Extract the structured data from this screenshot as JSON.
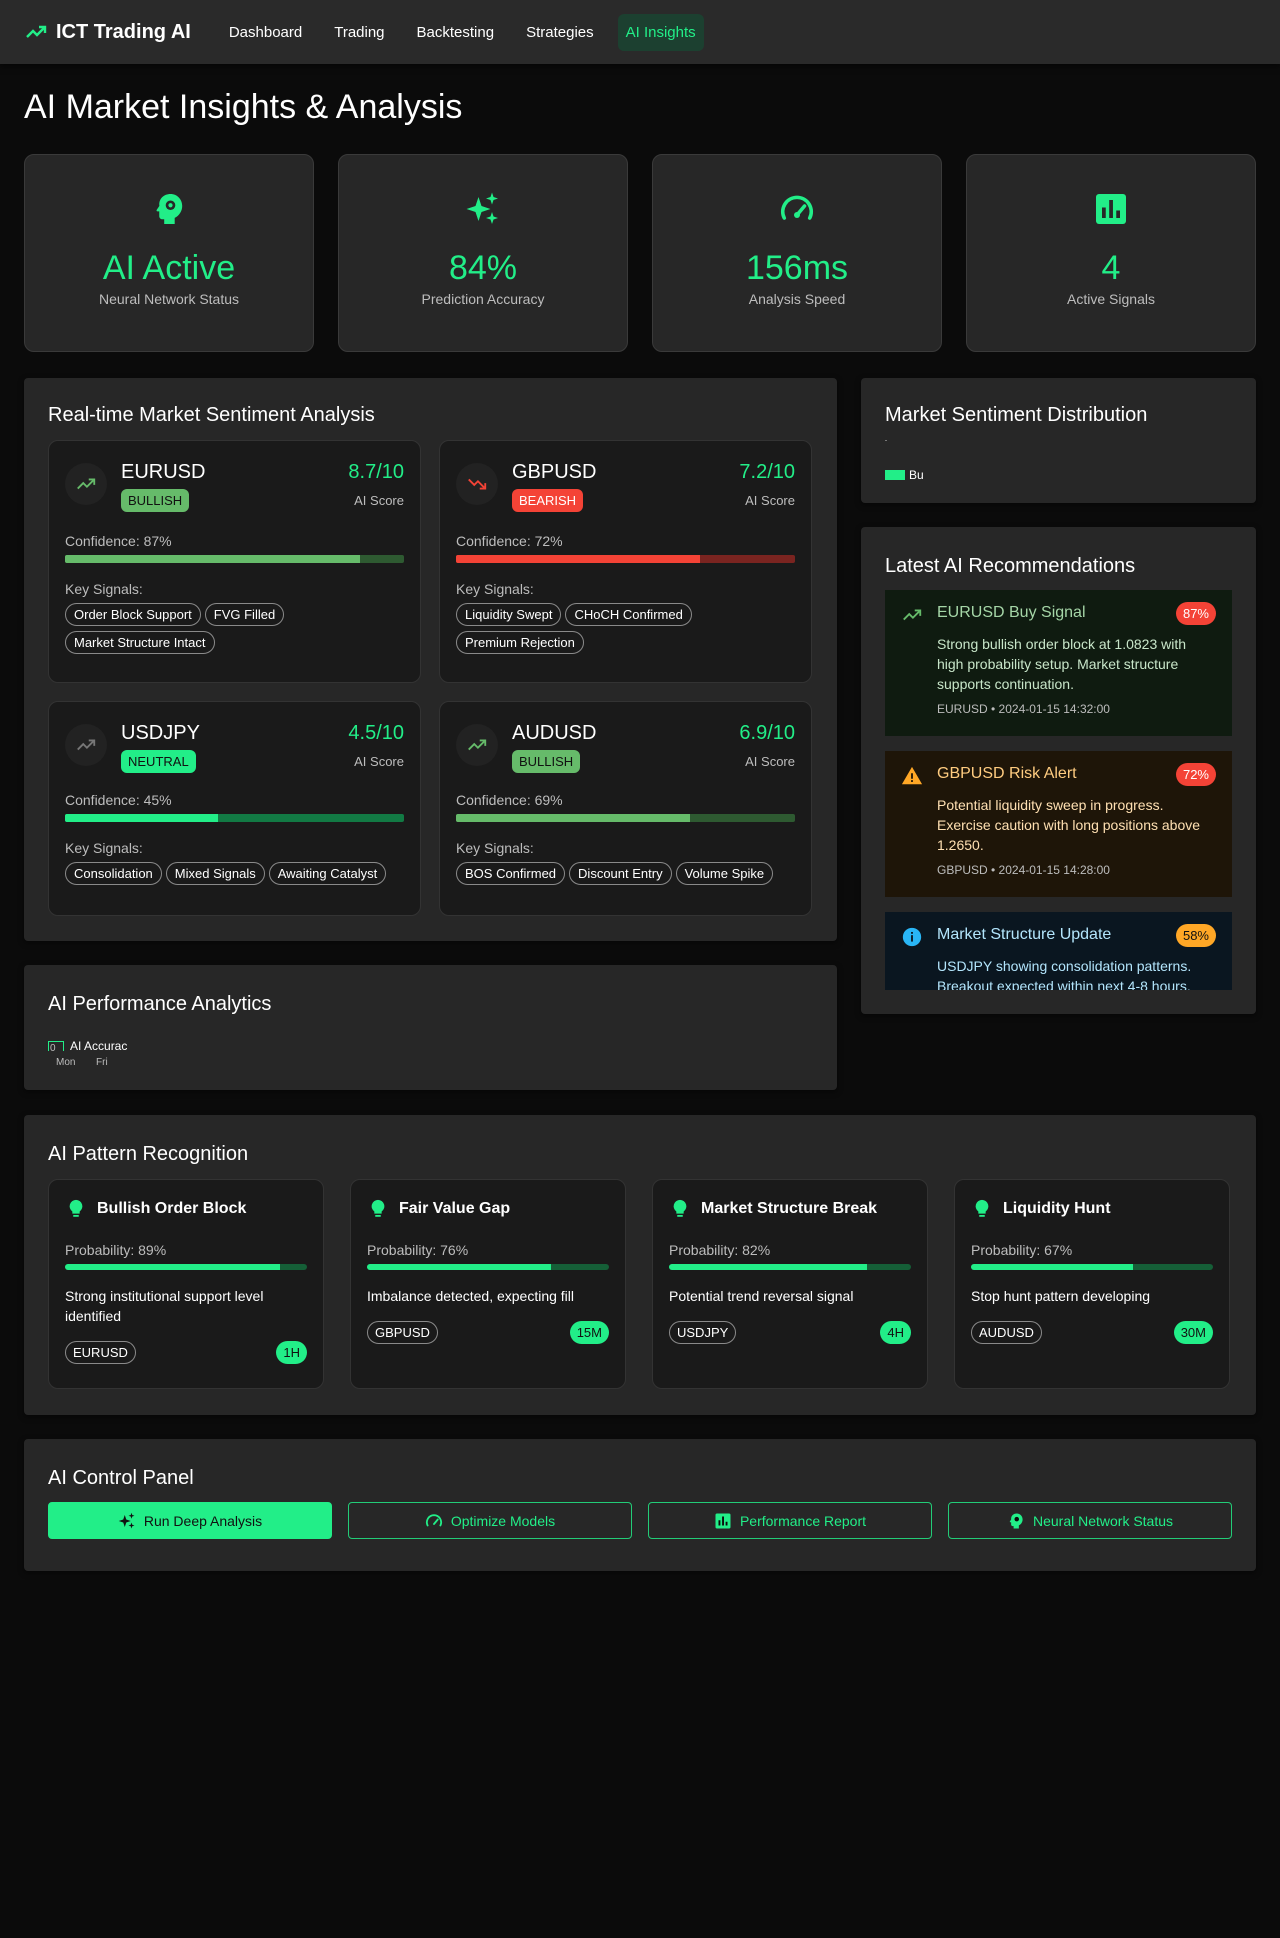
{
  "colors": {
    "accent": "#22ee88",
    "bullish": "#66bb6a",
    "bearish": "#f44336",
    "warning": "#ffa726",
    "info": "#29b6f6"
  },
  "nav": {
    "brand": "ICT Trading AI",
    "links": [
      "Dashboard",
      "Trading",
      "Backtesting",
      "Strategies",
      "AI Insights"
    ],
    "active": "AI Insights"
  },
  "page": {
    "title": "AI Market Insights & Analysis"
  },
  "stats": [
    {
      "icon": "brain-gear-icon",
      "value": "AI Active",
      "label": "Neural Network Status"
    },
    {
      "icon": "sparkles-icon",
      "value": "84%",
      "label": "Prediction Accuracy"
    },
    {
      "icon": "speedometer-icon",
      "value": "156ms",
      "label": "Analysis Speed"
    },
    {
      "icon": "bar-chart-icon",
      "value": "4",
      "label": "Active Signals"
    }
  ],
  "sentiment": {
    "title": "Real-time Market Sentiment Analysis",
    "cards": [
      {
        "pair": "EURUSD",
        "badge": "BULLISH",
        "score": "8.7/10",
        "score_label": "AI Score",
        "confidence_text": "Confidence: 87%",
        "confidence": 0.87,
        "signals_label": "Key Signals:",
        "signals": [
          "Order Block Support",
          "FVG Filled",
          "Market Structure Intact"
        ]
      },
      {
        "pair": "GBPUSD",
        "badge": "BEARISH",
        "score": "7.2/10",
        "score_label": "AI Score",
        "confidence_text": "Confidence: 72%",
        "confidence": 0.72,
        "signals_label": "Key Signals:",
        "signals": [
          "Liquidity Swept",
          "CHoCH Confirmed",
          "Premium Rejection"
        ]
      },
      {
        "pair": "USDJPY",
        "badge": "NEUTRAL",
        "score": "4.5/10",
        "score_label": "AI Score",
        "confidence_text": "Confidence: 45%",
        "confidence": 0.45,
        "signals_label": "Key Signals:",
        "signals": [
          "Consolidation",
          "Mixed Signals",
          "Awaiting Catalyst"
        ]
      },
      {
        "pair": "AUDUSD",
        "badge": "BULLISH",
        "score": "6.9/10",
        "score_label": "AI Score",
        "confidence_text": "Confidence: 69%",
        "confidence": 0.69,
        "signals_label": "Key Signals:",
        "signals": [
          "BOS Confirmed",
          "Discount Entry",
          "Volume Spike"
        ]
      }
    ]
  },
  "distribution": {
    "title": "Market Sentiment Distribution",
    "legend_label": "Bu"
  },
  "recommendations": {
    "title": "Latest AI Recommendations",
    "items": [
      {
        "icon": "trending-up-icon",
        "title": "EURUSD Buy Signal",
        "pct": "87%",
        "text": "Strong bullish order block at 1.0823 with high probability setup. Market structure supports continuation.",
        "meta": "EURUSD • 2024-01-15 14:32:00"
      },
      {
        "icon": "warning-icon",
        "title": "GBPUSD Risk Alert",
        "pct": "72%",
        "text": "Potential liquidity sweep in progress. Exercise caution with long positions above 1.2650.",
        "meta": "GBPUSD • 2024-01-15 14:28:00"
      },
      {
        "icon": "info-icon",
        "title": "Market Structure Update",
        "pct": "58%",
        "text": "USDJPY showing consolidation patterns. Breakout expected within next 4-8 hours.",
        "meta": ""
      }
    ]
  },
  "performance": {
    "title": "AI Performance Analytics",
    "y_tick": "0",
    "legend": "AI Accurac",
    "x_labels": [
      "Mon",
      "Fri"
    ]
  },
  "patterns": {
    "title": "AI Pattern Recognition",
    "items": [
      {
        "name": "Bullish Order Block",
        "prob_text": "Probability: 89%",
        "prob": 0.89,
        "desc": "Strong institutional support level identified",
        "pair": "EURUSD",
        "tf": "1H"
      },
      {
        "name": "Fair Value Gap",
        "prob_text": "Probability: 76%",
        "prob": 0.76,
        "desc": "Imbalance detected, expecting fill",
        "pair": "GBPUSD",
        "tf": "15M"
      },
      {
        "name": "Market Structure Break",
        "prob_text": "Probability: 82%",
        "prob": 0.82,
        "desc": "Potential trend reversal signal",
        "pair": "USDJPY",
        "tf": "4H"
      },
      {
        "name": "Liquidity Hunt",
        "prob_text": "Probability: 67%",
        "prob": 0.67,
        "desc": "Stop hunt pattern developing",
        "pair": "AUDUSD",
        "tf": "30M"
      }
    ]
  },
  "control": {
    "title": "AI Control Panel",
    "buttons": [
      "Run Deep Analysis",
      "Optimize Models",
      "Performance Report",
      "Neural Network Status"
    ]
  }
}
